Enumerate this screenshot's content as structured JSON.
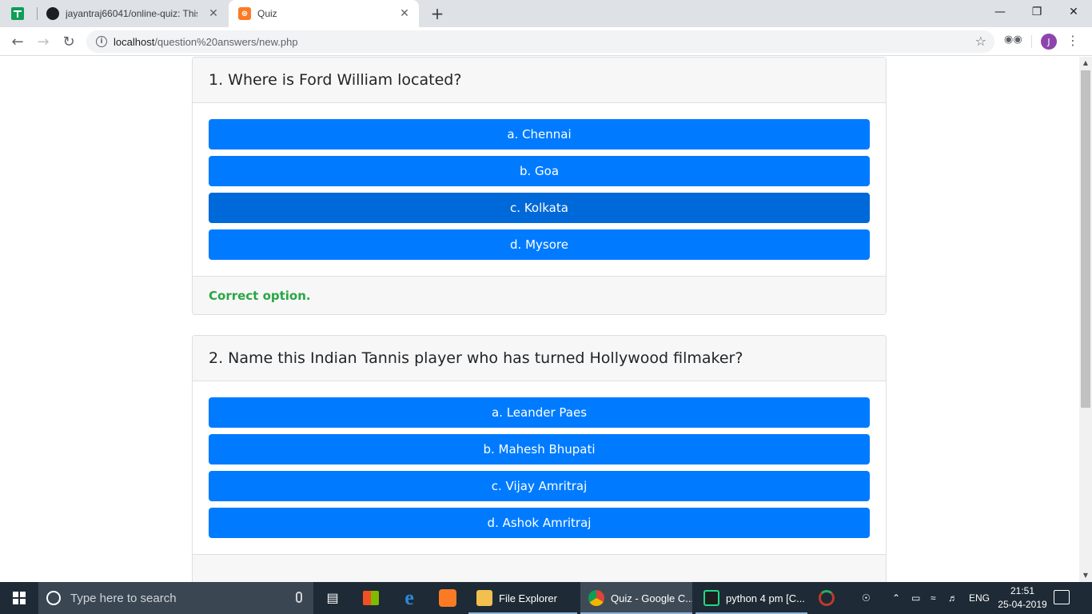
{
  "browser": {
    "tabs": [
      {
        "title": "jayantraj66041/online-quiz: This …",
        "close": "✕"
      },
      {
        "title": "Quiz",
        "close": "✕",
        "active": true
      }
    ],
    "new_tab": "+",
    "window_controls": {
      "minimize": "—",
      "maximize": "❐",
      "close": "✕"
    },
    "nav": {
      "back": "←",
      "forward": "→",
      "reload": "↻"
    },
    "url": {
      "host": "localhost",
      "path": "/question%20answers/new.php"
    },
    "star": "☆",
    "profile_initial": "J",
    "menu": "⋮"
  },
  "quiz": {
    "questions": [
      {
        "question": "1. Where is Ford William located?",
        "options": [
          "a. Chennai",
          "b. Goa",
          "c. Kolkata",
          "d. Mysore"
        ],
        "selected_index": 2,
        "feedback": "Correct option."
      },
      {
        "question": "2. Name this Indian Tannis player who has turned Hollywood filmaker?",
        "options": [
          "a. Leander Paes",
          "b. Mahesh Bhupati",
          "c. Vijay Amritraj",
          "d. Ashok Amritraj"
        ],
        "feedback": ""
      }
    ]
  },
  "taskbar": {
    "search_placeholder": "Type here to search",
    "apps": [
      {
        "label": "File Explorer"
      },
      {
        "label": "Quiz - Google C..."
      },
      {
        "label": "python 4 pm [C..."
      }
    ],
    "tray": {
      "language": "ENG"
    },
    "clock": {
      "time": "21:51",
      "date": "25-04-2019"
    }
  },
  "colors": {
    "primary": "#007bff",
    "primary_active": "#0069d9",
    "success": "#28a745",
    "taskbar": "#1e2a35"
  }
}
